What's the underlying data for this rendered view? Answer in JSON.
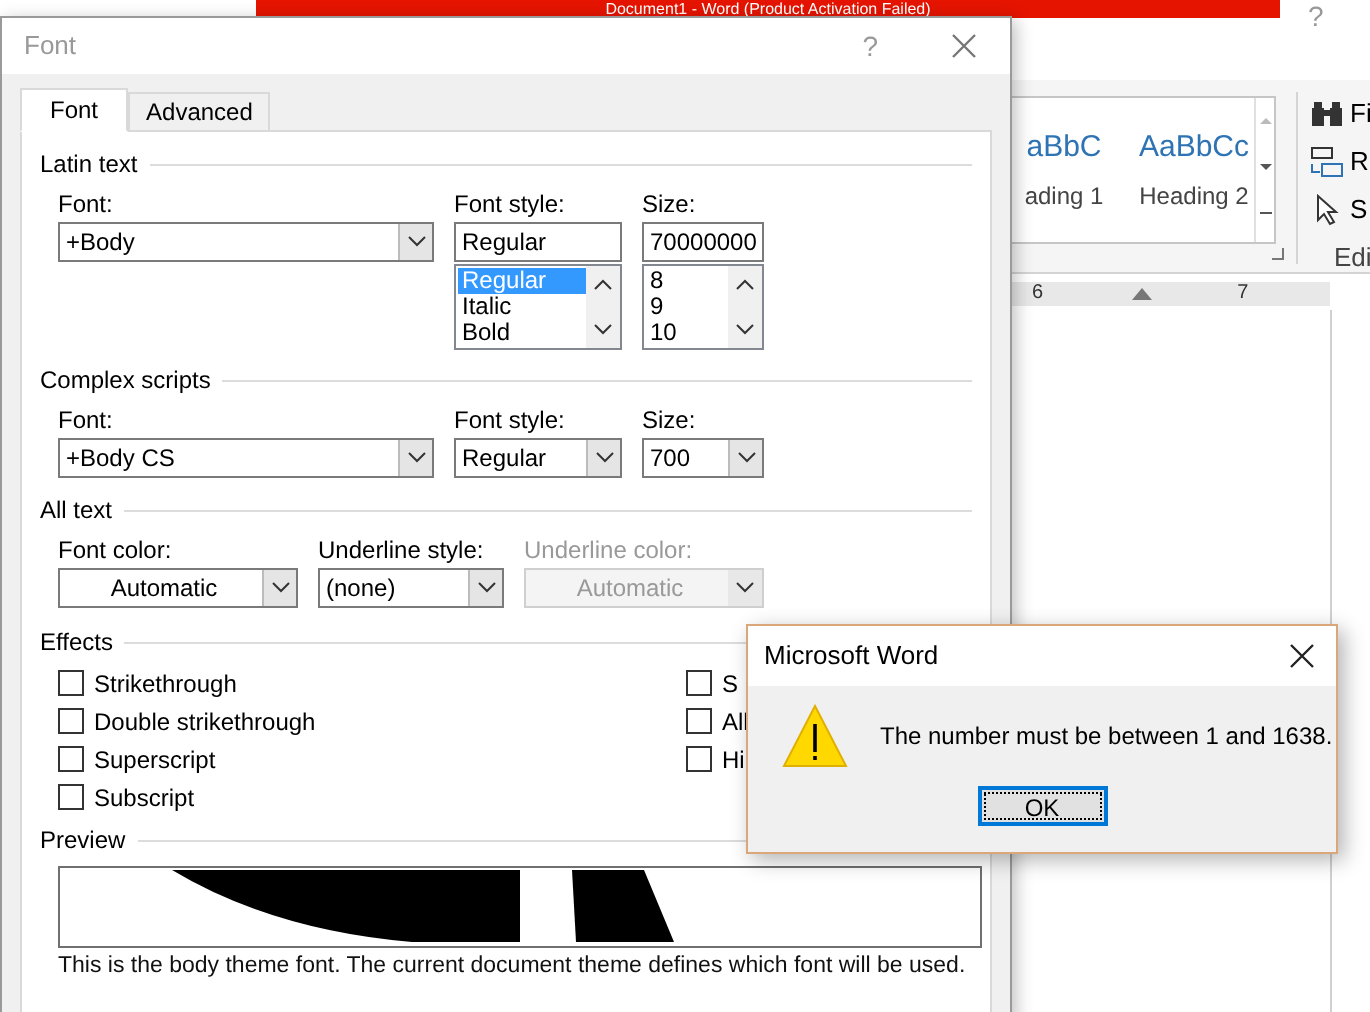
{
  "app_window": {
    "title": "Document1 - Word (Product Activation Failed)",
    "help": "?",
    "styles": [
      {
        "preview": "aBbC",
        "name": "ading 1"
      },
      {
        "preview": "AaBbCc",
        "name": "Heading 2"
      }
    ],
    "editing": [
      {
        "kind": "find",
        "label": "Fi"
      },
      {
        "kind": "replace",
        "label": "R"
      },
      {
        "kind": "select",
        "label": "S"
      }
    ],
    "group_label": "Edi",
    "ruler": [
      "6",
      "7"
    ]
  },
  "font_dialog": {
    "title": "Font",
    "help": "?",
    "tabs": [
      {
        "label": "Font",
        "selected": true
      },
      {
        "label": "Advanced",
        "selected": false
      }
    ],
    "latin_text": {
      "heading": "Latin text",
      "font": {
        "label": "Font:",
        "value": "+Body"
      },
      "font_style": {
        "label": "Font style:",
        "value": "Regular",
        "options": [
          {
            "label": "Regular",
            "selected": true
          },
          {
            "label": "Italic",
            "selected": false
          },
          {
            "label": "Bold",
            "selected": false
          }
        ]
      },
      "size": {
        "label": "Size:",
        "value": "70000000",
        "options": [
          {
            "label": "8",
            "selected": false
          },
          {
            "label": "9",
            "selected": false
          },
          {
            "label": "10",
            "selected": false
          }
        ]
      }
    },
    "complex_scripts": {
      "heading": "Complex scripts",
      "font": {
        "label": "Font:",
        "value": "+Body CS"
      },
      "font_style": {
        "label": "Font style:",
        "value": "Regular"
      },
      "size": {
        "label": "Size:",
        "value": "700"
      }
    },
    "all_text": {
      "heading": "All text",
      "font_color": {
        "label": "Font color:",
        "value": "Automatic",
        "disabled": false
      },
      "underline_style": {
        "label": "Underline style:",
        "value": "(none)",
        "disabled": false
      },
      "underline_color": {
        "label": "Underline color:",
        "value": "Automatic",
        "disabled": true
      }
    },
    "effects": {
      "heading": "Effects",
      "left": [
        {
          "label": "Strikethrough",
          "checked": false
        },
        {
          "label": "Double strikethrough",
          "checked": false
        },
        {
          "label": "Superscript",
          "checked": false
        },
        {
          "label": "Subscript",
          "checked": false
        }
      ],
      "right": [
        {
          "label": "S",
          "checked": false
        },
        {
          "label": "All",
          "checked": false
        },
        {
          "label": "Hi",
          "checked": false
        }
      ]
    },
    "preview": {
      "heading": "Preview",
      "caption": "This is the body theme font. The current document theme defines which font will be used."
    }
  },
  "message_box": {
    "title": "Microsoft Word",
    "message": "The number must be between 1 and 1638.",
    "buttons": [
      {
        "label": "OK",
        "focused": true
      }
    ]
  }
}
